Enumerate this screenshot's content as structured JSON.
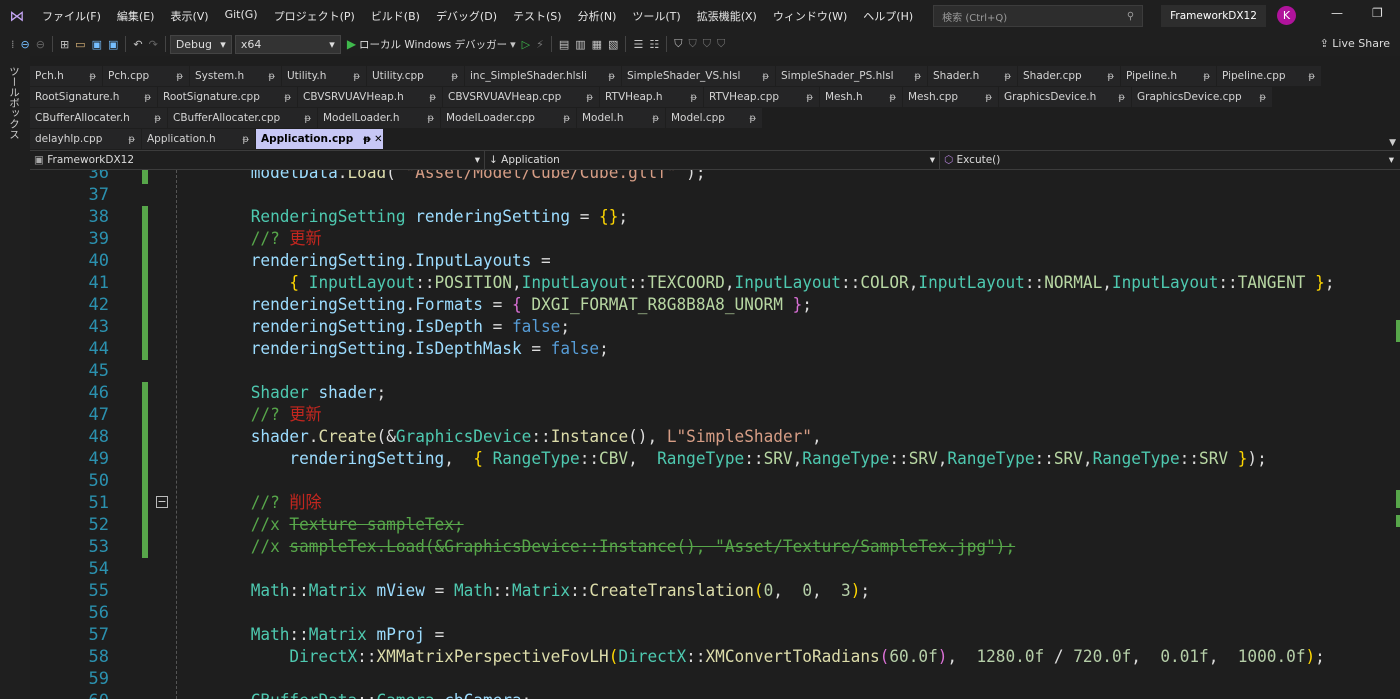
{
  "menubar": {
    "menus": [
      "ファイル(F)",
      "編集(E)",
      "表示(V)",
      "Git(G)",
      "プロジェクト(P)",
      "ビルド(B)",
      "デバッグ(D)",
      "テスト(S)",
      "分析(N)",
      "ツール(T)",
      "拡張機能(X)",
      "ウィンドウ(W)",
      "ヘルプ(H)"
    ],
    "search_placeholder": "検索 (Ctrl+Q)",
    "project_name": "FrameworkDX12",
    "avatar_letter": "K"
  },
  "toolbar": {
    "config": "Debug",
    "platform": "x64",
    "run_label": "ローカル Windows デバッガー",
    "live_share": "Live Share"
  },
  "left_strip": {
    "toolbox": "ツールボックス"
  },
  "tabs": {
    "rows": [
      [
        "Pch.h",
        "Pch.cpp",
        "System.h",
        "Utility.h",
        "Utility.cpp",
        "inc_SimpleShader.hlsli",
        "SimpleShader_VS.hlsl",
        "SimpleShader_PS.hlsl",
        "Shader.h",
        "Shader.cpp",
        "Pipeline.h",
        "Pipeline.cpp"
      ],
      [
        "RootSignature.h",
        "RootSignature.cpp",
        "CBVSRVUAVHeap.h",
        "CBVSRVUAVHeap.cpp",
        "RTVHeap.h",
        "RTVHeap.cpp",
        "Mesh.h",
        "Mesh.cpp",
        "GraphicsDevice.h",
        "GraphicsDevice.cpp"
      ],
      [
        "CBufferAllocater.h",
        "CBufferAllocater.cpp",
        "ModelLoader.h",
        "ModelLoader.cpp",
        "Model.h",
        "Model.cpp"
      ],
      [
        "delayhlp.cpp",
        "Application.h",
        "Application.cpp"
      ]
    ],
    "active": "Application.cpp",
    "pin_glyph": "ᵽ",
    "close_glyph": "✕"
  },
  "navbar": {
    "project": "FrameworkDX12",
    "scope": "Application",
    "member": "Excute()"
  },
  "editor": {
    "lines": [
      {
        "n": "36",
        "changed": true,
        "fold": false,
        "tokens": [
          [
            "    ",
            "p"
          ],
          [
            "modelData",
            "v"
          ],
          [
            ".",
            "p"
          ],
          [
            "Load",
            "f"
          ],
          [
            "( ",
            "p"
          ],
          [
            "\"Asset/Model/Cube/Cube.gltf\"",
            "s"
          ],
          [
            " );",
            "p"
          ]
        ]
      },
      {
        "n": "37",
        "changed": false,
        "fold": false,
        "tokens": []
      },
      {
        "n": "38",
        "changed": true,
        "fold": false,
        "tokens": [
          [
            "    ",
            "p"
          ],
          [
            "RenderingSetting",
            "ty"
          ],
          [
            " ",
            "p"
          ],
          [
            "renderingSetting",
            "v"
          ],
          [
            " = ",
            "p"
          ],
          [
            "{}",
            "b"
          ],
          [
            ";",
            "p"
          ]
        ]
      },
      {
        "n": "39",
        "changed": true,
        "fold": false,
        "tokens": [
          [
            "    ",
            "p"
          ],
          [
            "//? ",
            "c"
          ],
          [
            "更新",
            "j"
          ]
        ]
      },
      {
        "n": "40",
        "changed": true,
        "fold": false,
        "tokens": [
          [
            "    ",
            "p"
          ],
          [
            "renderingSetting",
            "v"
          ],
          [
            ".",
            "p"
          ],
          [
            "InputLayouts",
            "v"
          ],
          [
            " =",
            "p"
          ]
        ]
      },
      {
        "n": "41",
        "changed": true,
        "fold": false,
        "tokens": [
          [
            "        ",
            "p"
          ],
          [
            "{ ",
            "b"
          ],
          [
            "InputLayout",
            "ty"
          ],
          [
            "::",
            "p"
          ],
          [
            "POSITION",
            "e"
          ],
          [
            ",",
            "p"
          ],
          [
            "InputLayout",
            "ty"
          ],
          [
            "::",
            "p"
          ],
          [
            "TEXCOORD",
            "e"
          ],
          [
            ",",
            "p"
          ],
          [
            "InputLayout",
            "ty"
          ],
          [
            "::",
            "p"
          ],
          [
            "COLOR",
            "e"
          ],
          [
            ",",
            "p"
          ],
          [
            "InputLayout",
            "ty"
          ],
          [
            "::",
            "p"
          ],
          [
            "NORMAL",
            "e"
          ],
          [
            ",",
            "p"
          ],
          [
            "InputLayout",
            "ty"
          ],
          [
            "::",
            "p"
          ],
          [
            "TANGENT",
            "e"
          ],
          [
            " }",
            "b"
          ],
          [
            ";",
            "p"
          ]
        ]
      },
      {
        "n": "42",
        "changed": true,
        "fold": false,
        "tokens": [
          [
            "    ",
            "p"
          ],
          [
            "renderingSetting",
            "v"
          ],
          [
            ".",
            "p"
          ],
          [
            "Formats",
            "v"
          ],
          [
            " = ",
            "p"
          ],
          [
            "{ ",
            "r"
          ],
          [
            "DXGI_FORMAT_R8G8B8A8_UNORM",
            "e"
          ],
          [
            " }",
            "r"
          ],
          [
            ";",
            "p"
          ]
        ]
      },
      {
        "n": "43",
        "changed": true,
        "fold": false,
        "tokens": [
          [
            "    ",
            "p"
          ],
          [
            "renderingSetting",
            "v"
          ],
          [
            ".",
            "p"
          ],
          [
            "IsDepth",
            "v"
          ],
          [
            " = ",
            "p"
          ],
          [
            "false",
            "k"
          ],
          [
            ";",
            "p"
          ]
        ]
      },
      {
        "n": "44",
        "changed": true,
        "fold": false,
        "tokens": [
          [
            "    ",
            "p"
          ],
          [
            "renderingSetting",
            "v"
          ],
          [
            ".",
            "p"
          ],
          [
            "IsDepthMask",
            "v"
          ],
          [
            " = ",
            "p"
          ],
          [
            "false",
            "k"
          ],
          [
            ";",
            "p"
          ]
        ]
      },
      {
        "n": "45",
        "changed": false,
        "fold": false,
        "tokens": []
      },
      {
        "n": "46",
        "changed": true,
        "fold": false,
        "tokens": [
          [
            "    ",
            "p"
          ],
          [
            "Shader",
            "ty"
          ],
          [
            " ",
            "p"
          ],
          [
            "shader",
            "v"
          ],
          [
            ";",
            "p"
          ]
        ]
      },
      {
        "n": "47",
        "changed": true,
        "fold": false,
        "tokens": [
          [
            "    ",
            "p"
          ],
          [
            "//? ",
            "c"
          ],
          [
            "更新",
            "j"
          ]
        ]
      },
      {
        "n": "48",
        "changed": true,
        "fold": false,
        "tokens": [
          [
            "    ",
            "p"
          ],
          [
            "shader",
            "v"
          ],
          [
            ".",
            "p"
          ],
          [
            "Create",
            "f"
          ],
          [
            "(",
            "p"
          ],
          [
            "&",
            "p"
          ],
          [
            "GraphicsDevice",
            "ty"
          ],
          [
            "::",
            "p"
          ],
          [
            "Instance",
            "f"
          ],
          [
            "(), ",
            "p"
          ],
          [
            "L\"SimpleShader\"",
            "s"
          ],
          [
            ",",
            "p"
          ]
        ]
      },
      {
        "n": "49",
        "changed": true,
        "fold": false,
        "tokens": [
          [
            "        ",
            "p"
          ],
          [
            "renderingSetting",
            "v"
          ],
          [
            ",  ",
            "p"
          ],
          [
            "{ ",
            "b"
          ],
          [
            "RangeType",
            "ty"
          ],
          [
            "::",
            "p"
          ],
          [
            "CBV",
            "e"
          ],
          [
            ",  ",
            "p"
          ],
          [
            "RangeType",
            "ty"
          ],
          [
            "::",
            "p"
          ],
          [
            "SRV",
            "e"
          ],
          [
            ",",
            "p"
          ],
          [
            "RangeType",
            "ty"
          ],
          [
            "::",
            "p"
          ],
          [
            "SRV",
            "e"
          ],
          [
            ",",
            "p"
          ],
          [
            "RangeType",
            "ty"
          ],
          [
            "::",
            "p"
          ],
          [
            "SRV",
            "e"
          ],
          [
            ",",
            "p"
          ],
          [
            "RangeType",
            "ty"
          ],
          [
            "::",
            "p"
          ],
          [
            "SRV",
            "e"
          ],
          [
            " }",
            "b"
          ],
          [
            ");",
            "p"
          ]
        ]
      },
      {
        "n": "50",
        "changed": true,
        "fold": false,
        "tokens": []
      },
      {
        "n": "51",
        "changed": true,
        "fold": true,
        "tokens": [
          [
            "    ",
            "p"
          ],
          [
            "//? ",
            "c"
          ],
          [
            "削除",
            "j"
          ]
        ]
      },
      {
        "n": "52",
        "changed": true,
        "fold": false,
        "tokens": [
          [
            "    ",
            "p"
          ],
          [
            "//x ",
            "c"
          ],
          [
            "Texture sampleTex;",
            "c-strike"
          ]
        ]
      },
      {
        "n": "53",
        "changed": true,
        "fold": false,
        "tokens": [
          [
            "    ",
            "p"
          ],
          [
            "//x ",
            "c"
          ],
          [
            "sampleTex.Load(&GraphicsDevice::Instance(), \"Asset/Texture/SampleTex.jpg\");",
            "c-strike"
          ]
        ]
      },
      {
        "n": "54",
        "changed": false,
        "fold": false,
        "tokens": []
      },
      {
        "n": "55",
        "changed": false,
        "fold": false,
        "tokens": [
          [
            "    ",
            "p"
          ],
          [
            "Math",
            "ty"
          ],
          [
            "::",
            "p"
          ],
          [
            "Matrix",
            "ty"
          ],
          [
            " ",
            "p"
          ],
          [
            "mView",
            "v"
          ],
          [
            " = ",
            "p"
          ],
          [
            "Math",
            "ty"
          ],
          [
            "::",
            "p"
          ],
          [
            "Matrix",
            "ty"
          ],
          [
            "::",
            "p"
          ],
          [
            "CreateTranslation",
            "f"
          ],
          [
            "(",
            "b"
          ],
          [
            "0",
            "n"
          ],
          [
            ",  ",
            "p"
          ],
          [
            "0",
            "n"
          ],
          [
            ",  ",
            "p"
          ],
          [
            "3",
            "n"
          ],
          [
            ")",
            "b"
          ],
          [
            ";",
            "p"
          ]
        ]
      },
      {
        "n": "56",
        "changed": false,
        "fold": false,
        "tokens": []
      },
      {
        "n": "57",
        "changed": false,
        "fold": false,
        "tokens": [
          [
            "    ",
            "p"
          ],
          [
            "Math",
            "ty"
          ],
          [
            "::",
            "p"
          ],
          [
            "Matrix",
            "ty"
          ],
          [
            " ",
            "p"
          ],
          [
            "mProj",
            "v"
          ],
          [
            " =",
            "p"
          ]
        ]
      },
      {
        "n": "58",
        "changed": false,
        "fold": false,
        "tokens": [
          [
            "        ",
            "p"
          ],
          [
            "DirectX",
            "ty"
          ],
          [
            "::",
            "p"
          ],
          [
            "XMMatrixPerspectiveFovLH",
            "f"
          ],
          [
            "(",
            "b"
          ],
          [
            "DirectX",
            "ty"
          ],
          [
            "::",
            "p"
          ],
          [
            "XMConvertToRadians",
            "f"
          ],
          [
            "(",
            "r"
          ],
          [
            "60.0f",
            "n"
          ],
          [
            ")",
            "r"
          ],
          [
            ",  ",
            "p"
          ],
          [
            "1280.0f",
            "n"
          ],
          [
            " / ",
            "p"
          ],
          [
            "720.0f",
            "n"
          ],
          [
            ",  ",
            "p"
          ],
          [
            "0.01f",
            "n"
          ],
          [
            ",  ",
            "p"
          ],
          [
            "1000.0f",
            "n"
          ],
          [
            ")",
            "b"
          ],
          [
            ";",
            "p"
          ]
        ]
      },
      {
        "n": "59",
        "changed": false,
        "fold": false,
        "tokens": []
      },
      {
        "n": "60",
        "changed": false,
        "fold": false,
        "tokens": [
          [
            "    ",
            "p"
          ],
          [
            "CBufferData",
            "ty"
          ],
          [
            "::",
            "p"
          ],
          [
            "Camera",
            "ty"
          ],
          [
            " ",
            "p"
          ],
          [
            "cbCamera",
            "v"
          ],
          [
            ";",
            "p"
          ]
        ]
      }
    ]
  },
  "colors": {
    "accent": "#c7c7f5",
    "changed": "#57a64a",
    "line_number": "#2b91af"
  }
}
